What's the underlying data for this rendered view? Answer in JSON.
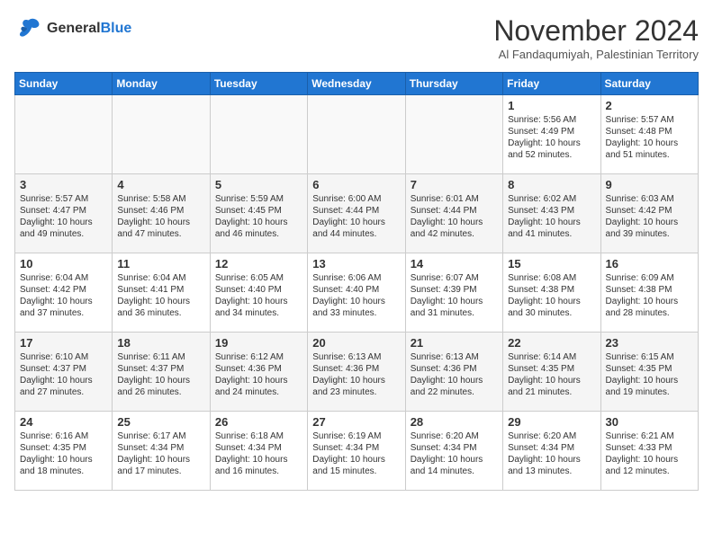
{
  "logo": {
    "line1": "General",
    "line2": "Blue"
  },
  "title": "November 2024",
  "subtitle": "Al Fandaqumiyah, Palestinian Territory",
  "days_of_week": [
    "Sunday",
    "Monday",
    "Tuesday",
    "Wednesday",
    "Thursday",
    "Friday",
    "Saturday"
  ],
  "weeks": [
    [
      {
        "day": "",
        "info": ""
      },
      {
        "day": "",
        "info": ""
      },
      {
        "day": "",
        "info": ""
      },
      {
        "day": "",
        "info": ""
      },
      {
        "day": "",
        "info": ""
      },
      {
        "day": "1",
        "info": "Sunrise: 5:56 AM\nSunset: 4:49 PM\nDaylight: 10 hours and 52 minutes."
      },
      {
        "day": "2",
        "info": "Sunrise: 5:57 AM\nSunset: 4:48 PM\nDaylight: 10 hours and 51 minutes."
      }
    ],
    [
      {
        "day": "3",
        "info": "Sunrise: 5:57 AM\nSunset: 4:47 PM\nDaylight: 10 hours and 49 minutes."
      },
      {
        "day": "4",
        "info": "Sunrise: 5:58 AM\nSunset: 4:46 PM\nDaylight: 10 hours and 47 minutes."
      },
      {
        "day": "5",
        "info": "Sunrise: 5:59 AM\nSunset: 4:45 PM\nDaylight: 10 hours and 46 minutes."
      },
      {
        "day": "6",
        "info": "Sunrise: 6:00 AM\nSunset: 4:44 PM\nDaylight: 10 hours and 44 minutes."
      },
      {
        "day": "7",
        "info": "Sunrise: 6:01 AM\nSunset: 4:44 PM\nDaylight: 10 hours and 42 minutes."
      },
      {
        "day": "8",
        "info": "Sunrise: 6:02 AM\nSunset: 4:43 PM\nDaylight: 10 hours and 41 minutes."
      },
      {
        "day": "9",
        "info": "Sunrise: 6:03 AM\nSunset: 4:42 PM\nDaylight: 10 hours and 39 minutes."
      }
    ],
    [
      {
        "day": "10",
        "info": "Sunrise: 6:04 AM\nSunset: 4:42 PM\nDaylight: 10 hours and 37 minutes."
      },
      {
        "day": "11",
        "info": "Sunrise: 6:04 AM\nSunset: 4:41 PM\nDaylight: 10 hours and 36 minutes."
      },
      {
        "day": "12",
        "info": "Sunrise: 6:05 AM\nSunset: 4:40 PM\nDaylight: 10 hours and 34 minutes."
      },
      {
        "day": "13",
        "info": "Sunrise: 6:06 AM\nSunset: 4:40 PM\nDaylight: 10 hours and 33 minutes."
      },
      {
        "day": "14",
        "info": "Sunrise: 6:07 AM\nSunset: 4:39 PM\nDaylight: 10 hours and 31 minutes."
      },
      {
        "day": "15",
        "info": "Sunrise: 6:08 AM\nSunset: 4:38 PM\nDaylight: 10 hours and 30 minutes."
      },
      {
        "day": "16",
        "info": "Sunrise: 6:09 AM\nSunset: 4:38 PM\nDaylight: 10 hours and 28 minutes."
      }
    ],
    [
      {
        "day": "17",
        "info": "Sunrise: 6:10 AM\nSunset: 4:37 PM\nDaylight: 10 hours and 27 minutes."
      },
      {
        "day": "18",
        "info": "Sunrise: 6:11 AM\nSunset: 4:37 PM\nDaylight: 10 hours and 26 minutes."
      },
      {
        "day": "19",
        "info": "Sunrise: 6:12 AM\nSunset: 4:36 PM\nDaylight: 10 hours and 24 minutes."
      },
      {
        "day": "20",
        "info": "Sunrise: 6:13 AM\nSunset: 4:36 PM\nDaylight: 10 hours and 23 minutes."
      },
      {
        "day": "21",
        "info": "Sunrise: 6:13 AM\nSunset: 4:36 PM\nDaylight: 10 hours and 22 minutes."
      },
      {
        "day": "22",
        "info": "Sunrise: 6:14 AM\nSunset: 4:35 PM\nDaylight: 10 hours and 21 minutes."
      },
      {
        "day": "23",
        "info": "Sunrise: 6:15 AM\nSunset: 4:35 PM\nDaylight: 10 hours and 19 minutes."
      }
    ],
    [
      {
        "day": "24",
        "info": "Sunrise: 6:16 AM\nSunset: 4:35 PM\nDaylight: 10 hours and 18 minutes."
      },
      {
        "day": "25",
        "info": "Sunrise: 6:17 AM\nSunset: 4:34 PM\nDaylight: 10 hours and 17 minutes."
      },
      {
        "day": "26",
        "info": "Sunrise: 6:18 AM\nSunset: 4:34 PM\nDaylight: 10 hours and 16 minutes."
      },
      {
        "day": "27",
        "info": "Sunrise: 6:19 AM\nSunset: 4:34 PM\nDaylight: 10 hours and 15 minutes."
      },
      {
        "day": "28",
        "info": "Sunrise: 6:20 AM\nSunset: 4:34 PM\nDaylight: 10 hours and 14 minutes."
      },
      {
        "day": "29",
        "info": "Sunrise: 6:20 AM\nSunset: 4:34 PM\nDaylight: 10 hours and 13 minutes."
      },
      {
        "day": "30",
        "info": "Sunrise: 6:21 AM\nSunset: 4:33 PM\nDaylight: 10 hours and 12 minutes."
      }
    ]
  ]
}
